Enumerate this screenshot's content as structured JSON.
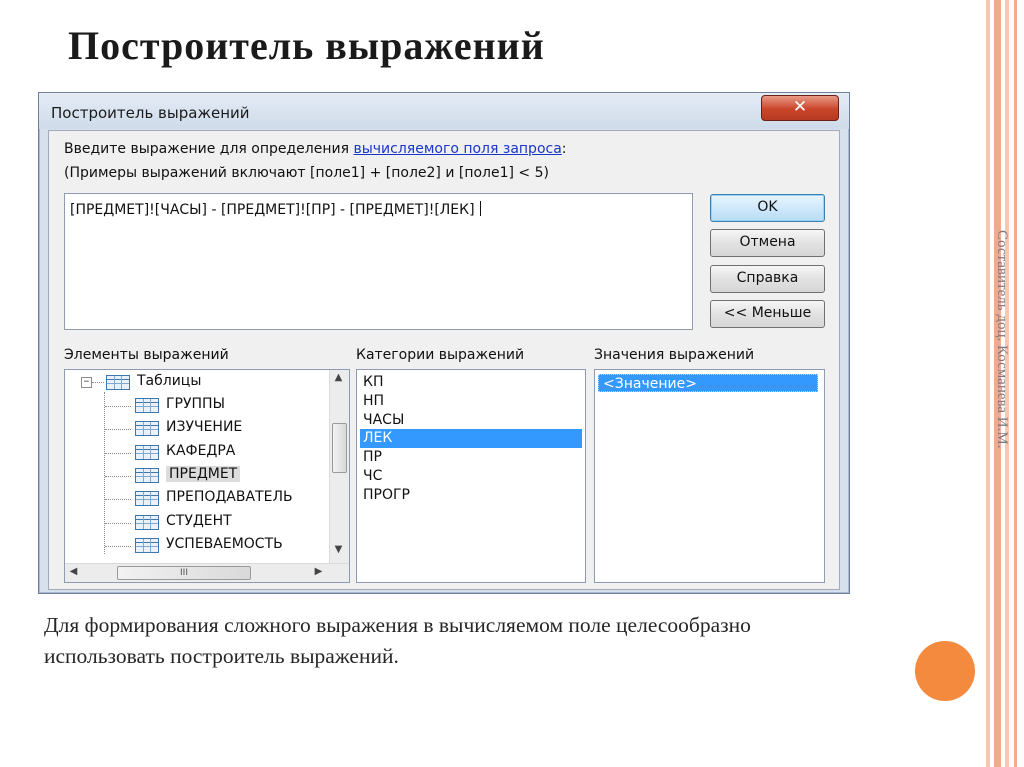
{
  "slide": {
    "title": "Построитель выражений",
    "side_note": "Составитель доц. Косманева И.М.",
    "description": "Для формирования сложного выражения в вычисляемом поле целесообразно использовать построитель выражений.",
    "accent_color": "#f38a3e",
    "stripe_colors": [
      "#f6c7b5",
      "#f3a98c",
      "#f6c7b5"
    ]
  },
  "dialog": {
    "title": "Построитель выражений",
    "close_glyph": "✕",
    "prompt_before": "Введите выражение для определения ",
    "prompt_link": "вычисляемого поля запроса",
    "prompt_after": ":",
    "examples": "(Примеры выражений включают [поле1] + [поле2] и [поле1] < 5)",
    "expression": "[ПРЕДМЕТ]![ЧАСЫ] - [ПРЕДМЕТ]![ПР] - [ПРЕДМЕТ]![ЛЕК]",
    "buttons": {
      "ok": "OK",
      "cancel": "Отмена",
      "help": "Справка",
      "less": "<< Меньше"
    },
    "elements_label": "Элементы выражений",
    "categories_label": "Категории выражений",
    "values_label": "Значения выражений",
    "tree": {
      "root": "Таблицы",
      "items": [
        "ГРУППЫ",
        "ИЗУЧЕНИЕ",
        "КАФЕДРА",
        "ПРЕДМЕТ",
        "ПРЕПОДАВАТЕЛЬ",
        "СТУДЕНТ",
        "УСПЕВАЕМОСТЬ"
      ],
      "selected": "ПРЕДМЕТ"
    },
    "categories": [
      "КП",
      "НП",
      "ЧАСЫ",
      "ЛЕК",
      "ПР",
      "ЧС",
      "ПРОГР"
    ],
    "selected_category": "ЛЕК",
    "values": [
      "<Значение>"
    ],
    "scroll_grip": "III"
  }
}
